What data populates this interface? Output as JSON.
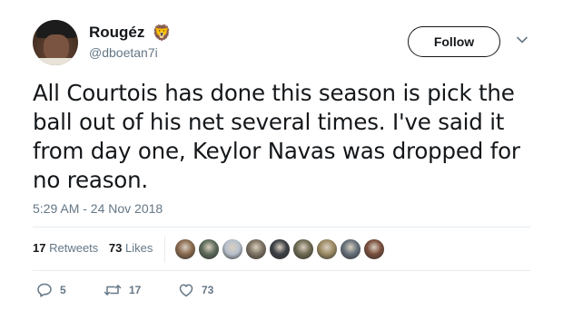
{
  "user": {
    "display_name": "Rougéz",
    "name_emoji": "🦁",
    "handle": "@dboetan7i"
  },
  "header": {
    "follow_label": "Follow",
    "caret_icon": "chevron-down-icon"
  },
  "tweet": {
    "text": "All Courtois has done this season is pick the ball out of his net several times. I've said it from day one, Keylor Navas was dropped for no reason.",
    "timestamp": "5:29 AM - 24 Nov 2018"
  },
  "stats": {
    "retweets_count": "17",
    "retweets_label": "Retweets",
    "likes_count": "73",
    "likes_label": "Likes"
  },
  "likers": [
    {
      "color": "#8a6a4f"
    },
    {
      "color": "#5d6b5a"
    },
    {
      "color": "#b8c2cc"
    },
    {
      "color": "#7d7262"
    },
    {
      "color": "#3c3f44"
    },
    {
      "color": "#6e6a52"
    },
    {
      "color": "#9c8b63"
    },
    {
      "color": "#66707a"
    },
    {
      "color": "#7a4f3d"
    }
  ],
  "actions": {
    "reply_count": "5",
    "retweet_count": "17",
    "like_count": "73"
  },
  "colors": {
    "text": "#14171a",
    "secondary": "#657786",
    "divider": "#e6ecf0"
  }
}
